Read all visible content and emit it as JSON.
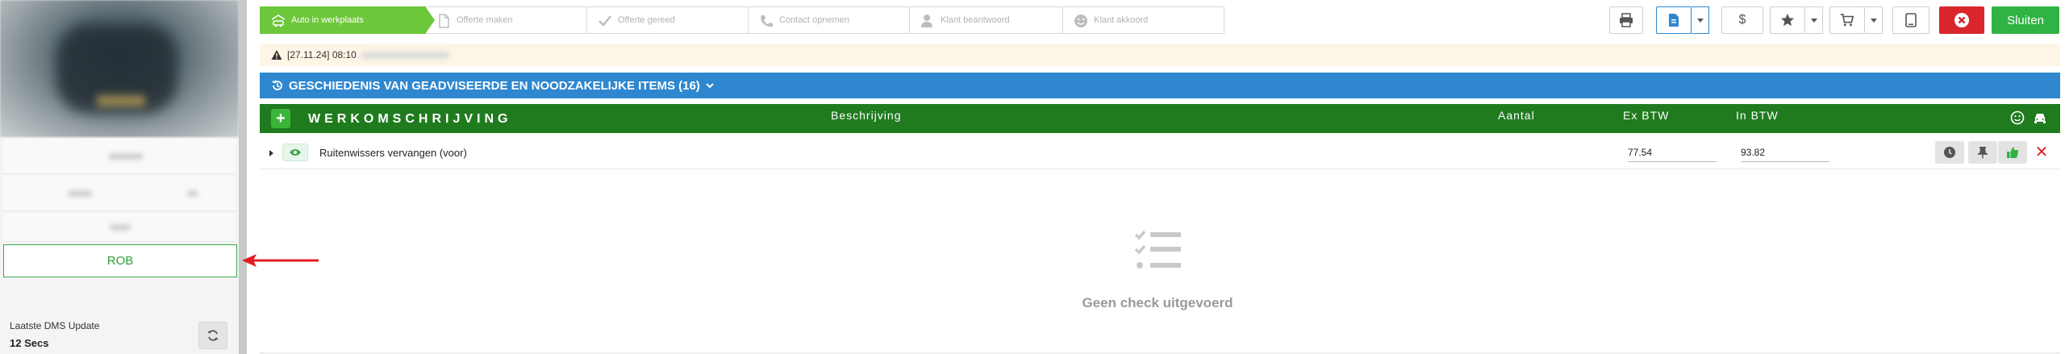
{
  "sidebar": {
    "customer_name": "ROB",
    "dms_update_label": "Laatste DMS Update",
    "dms_update_value": "12 Secs"
  },
  "steps": [
    {
      "label": "Auto in werkplaats",
      "icon": "car-garage-icon",
      "active": true
    },
    {
      "label": "Offerte maken",
      "icon": "document-icon",
      "active": false
    },
    {
      "label": "Offerte gereed",
      "icon": "check-icon",
      "active": false
    },
    {
      "label": "Contact opnemen",
      "icon": "phone-icon",
      "active": false
    },
    {
      "label": "Klant beantwoord",
      "icon": "user-icon",
      "active": false
    },
    {
      "label": "Klant akkoord",
      "icon": "smiley-icon",
      "active": false
    }
  ],
  "toolbar": {
    "close_label": "Sluiten",
    "dollar_symbol": "$"
  },
  "alert": {
    "date": "[27.11.24] 08:10"
  },
  "history": {
    "title": "GESCHIEDENIS VAN GEADVISEERDE EN NOODZAKELIJKE ITEMS (16)"
  },
  "work": {
    "title": "WERKOMSCHRIJVING",
    "col_description": "Beschrijving",
    "col_quantity": "Aantal",
    "col_ex_vat": "Ex BTW",
    "col_in_vat": "In BTW"
  },
  "items": [
    {
      "description": "Ruitenwissers vervangen (voor)",
      "ex_vat": "77.54",
      "in_vat": "93.82"
    }
  ],
  "empty_state": {
    "text": "Geen check uitgevoerd"
  },
  "colors": {
    "step_active": "#6cc73a",
    "history_bar": "#2e87cf",
    "work_header": "#207b1f",
    "close_green": "#2fb344",
    "cancel_red": "#d9262c"
  }
}
